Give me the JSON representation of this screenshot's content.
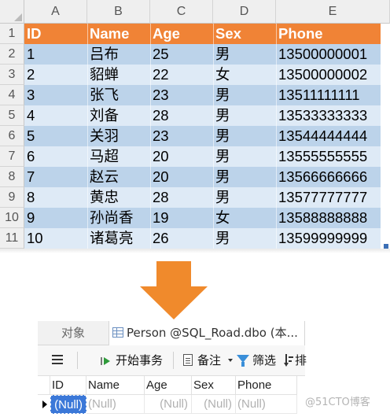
{
  "spreadsheet": {
    "columns": [
      "A",
      "B",
      "C",
      "D",
      "E"
    ],
    "row_numbers": [
      "1",
      "2",
      "3",
      "4",
      "5",
      "6",
      "7",
      "8",
      "9",
      "10",
      "11"
    ],
    "header": [
      "ID",
      "Name",
      "Age",
      "Sex",
      "Phone"
    ],
    "rows": [
      [
        "1",
        "吕布",
        "25",
        "男",
        "13500000001"
      ],
      [
        "2",
        "貂蝉",
        "22",
        "女",
        "13500000002"
      ],
      [
        "3",
        "张飞",
        "23",
        "男",
        "13511111111"
      ],
      [
        "4",
        "刘备",
        "28",
        "男",
        "13533333333"
      ],
      [
        "5",
        "关羽",
        "23",
        "男",
        "13544444444"
      ],
      [
        "6",
        "马超",
        "20",
        "男",
        "13555555555"
      ],
      [
        "7",
        "赵云",
        "20",
        "男",
        "13566666666"
      ],
      [
        "8",
        "黄忠",
        "28",
        "男",
        "13577777777"
      ],
      [
        "9",
        "孙尚香",
        "19",
        "女",
        "13588888888"
      ],
      [
        "10",
        "诸葛亮",
        "26",
        "男",
        "13599999999"
      ]
    ],
    "colors": {
      "header_bg": "#f08336",
      "band_a": "#bcd3ea",
      "band_b": "#deeaf6"
    }
  },
  "arrow": {
    "icon": "down-arrow-icon",
    "color": "#f08a2c"
  },
  "navicat": {
    "tabs": {
      "objects": "对象",
      "active": "Person @SQL_Road.dbo (本..."
    },
    "toolbar": {
      "begin_transaction": "开始事务",
      "note": "备注",
      "filter": "筛选",
      "sort": "排"
    },
    "grid": {
      "columns": [
        "ID",
        "Name",
        "Age",
        "Sex",
        "Phone"
      ],
      "row": [
        "(Null)",
        "(Null)",
        "(Null)",
        "(Null)",
        "(Null)"
      ],
      "selected_color": "#3b78d8"
    }
  },
  "watermark": "@51CTO博客"
}
